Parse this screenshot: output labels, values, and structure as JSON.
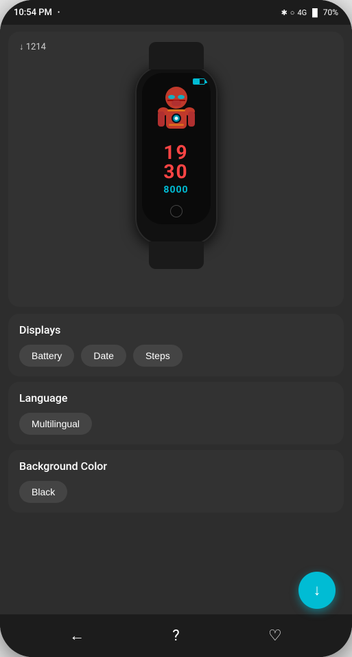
{
  "statusBar": {
    "time": "10:54 PM",
    "dot": "•",
    "battery": "70%",
    "icons": [
      "bluetooth",
      "wifi",
      "4g",
      "signal",
      "battery"
    ]
  },
  "watchPreview": {
    "downloadCount": "↓ 1214",
    "watchTime": {
      "hours": "19",
      "minutes": "30",
      "steps": "8000"
    }
  },
  "displays": {
    "title": "Displays",
    "chips": [
      "Battery",
      "Date",
      "Steps"
    ]
  },
  "language": {
    "title": "Language",
    "chips": [
      "Multilingual"
    ]
  },
  "backgroundColor": {
    "title": "Background Color",
    "chips": [
      "Black"
    ]
  },
  "bottomNav": {
    "back": "←",
    "help": "?",
    "favorite": "♡"
  },
  "fab": {
    "icon": "↓"
  }
}
